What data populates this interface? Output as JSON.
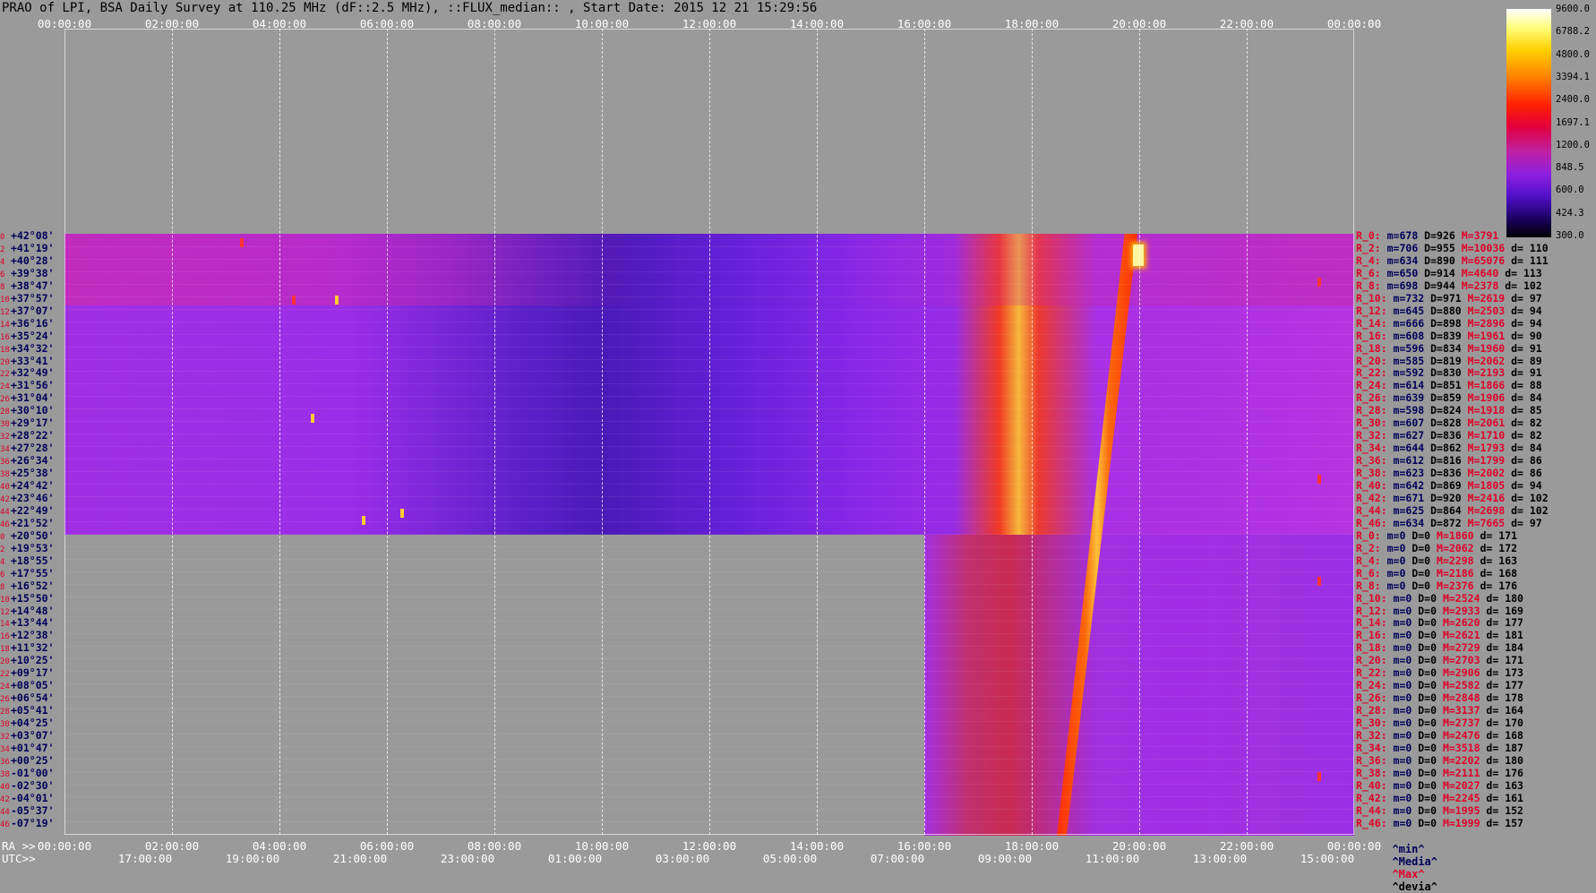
{
  "title": "PRAO of LPI, BSA Daily Survey at 110.25 MHz (dF::2.5 MHz), ::FLUX_median:: , Start Date: 2015 12 21 15:29:56",
  "top_ticks": [
    "00:00:00",
    "02:00:00",
    "04:00:00",
    "06:00:00",
    "08:00:00",
    "10:00:00",
    "12:00:00",
    "14:00:00",
    "16:00:00",
    "18:00:00",
    "20:00:00",
    "22:00:00",
    "00:00:00"
  ],
  "bottom_ra_ticks": [
    "00:00:00",
    "02:00:00",
    "04:00:00",
    "06:00:00",
    "08:00:00",
    "10:00:00",
    "12:00:00",
    "14:00:00",
    "16:00:00",
    "18:00:00",
    "20:00:00",
    "22:00:00",
    "00:00:00"
  ],
  "bottom_utc_ticks": [
    "17:00:00",
    "19:00:00",
    "21:00:00",
    "23:00:00",
    "01:00:00",
    "03:00:00",
    "05:00:00",
    "07:00:00",
    "09:00:00",
    "11:00:00",
    "13:00:00",
    "15:00:00"
  ],
  "ra_label": "RA >>",
  "utc_label": "UTC>>",
  "declinations": [
    {
      "idx": "0",
      "val": "+42°08'"
    },
    {
      "idx": "2",
      "val": "+41°19'"
    },
    {
      "idx": "4",
      "val": "+40°28'"
    },
    {
      "idx": "6",
      "val": "+39°38'"
    },
    {
      "idx": "8",
      "val": "+38°47'"
    },
    {
      "idx": "10",
      "val": "+37°57'"
    },
    {
      "idx": "12",
      "val": "+37°07'"
    },
    {
      "idx": "14",
      "val": "+36°16'"
    },
    {
      "idx": "16",
      "val": "+35°24'"
    },
    {
      "idx": "18",
      "val": "+34°32'"
    },
    {
      "idx": "20",
      "val": "+33°41'"
    },
    {
      "idx": "22",
      "val": "+32°49'"
    },
    {
      "idx": "24",
      "val": "+31°56'"
    },
    {
      "idx": "26",
      "val": "+31°04'"
    },
    {
      "idx": "28",
      "val": "+30°10'"
    },
    {
      "idx": "30",
      "val": "+29°17'"
    },
    {
      "idx": "32",
      "val": "+28°22'"
    },
    {
      "idx": "34",
      "val": "+27°28'"
    },
    {
      "idx": "36",
      "val": "+26°34'"
    },
    {
      "idx": "38",
      "val": "+25°38'"
    },
    {
      "idx": "40",
      "val": "+24°42'"
    },
    {
      "idx": "42",
      "val": "+23°46'"
    },
    {
      "idx": "44",
      "val": "+22°49'"
    },
    {
      "idx": "46",
      "val": "+21°52'"
    },
    {
      "idx": "0",
      "val": "+20°50'"
    },
    {
      "idx": "2",
      "val": "+19°53'"
    },
    {
      "idx": "4",
      "val": "+18°55'"
    },
    {
      "idx": "6",
      "val": "+17°55'"
    },
    {
      "idx": "8",
      "val": "+16°52'"
    },
    {
      "idx": "10",
      "val": "+15°50'"
    },
    {
      "idx": "12",
      "val": "+14°48'"
    },
    {
      "idx": "14",
      "val": "+13°44'"
    },
    {
      "idx": "16",
      "val": "+12°38'"
    },
    {
      "idx": "18",
      "val": "+11°32'"
    },
    {
      "idx": "20",
      "val": "+10°25'"
    },
    {
      "idx": "22",
      "val": "+09°17'"
    },
    {
      "idx": "24",
      "val": "+08°05'"
    },
    {
      "idx": "26",
      "val": "+06°54'"
    },
    {
      "idx": "28",
      "val": "+05°41'"
    },
    {
      "idx": "30",
      "val": "+04°25'"
    },
    {
      "idx": "32",
      "val": "+03°07'"
    },
    {
      "idx": "34",
      "val": "+01°47'"
    },
    {
      "idx": "36",
      "val": "+00°25'"
    },
    {
      "idx": "38",
      "val": "-01°00'"
    },
    {
      "idx": "40",
      "val": "-02°30'"
    },
    {
      "idx": "42",
      "val": "-04°01'"
    },
    {
      "idx": "44",
      "val": "-05°37'"
    },
    {
      "idx": "46",
      "val": "-07°19'"
    }
  ],
  "stats": [
    {
      "r": "R_0:",
      "m": "m=678",
      "D": "D=926",
      "M": "M=3791",
      "d": ""
    },
    {
      "r": "R_2:",
      "m": "m=706",
      "D": "D=955",
      "M": "M=10036",
      "d": "d= 110"
    },
    {
      "r": "R_4:",
      "m": "m=634",
      "D": "D=890",
      "M": "M=65076",
      "d": "d= 111"
    },
    {
      "r": "R_6:",
      "m": "m=650",
      "D": "D=914",
      "M": "M=4640",
      "d": "d= 113"
    },
    {
      "r": "R_8:",
      "m": "m=698",
      "D": "D=944",
      "M": "M=2378",
      "d": "d= 102"
    },
    {
      "r": "R_10:",
      "m": "m=732",
      "D": "D=971",
      "M": "M=2619",
      "d": "d= 97"
    },
    {
      "r": "R_12:",
      "m": "m=645",
      "D": "D=880",
      "M": "M=2503",
      "d": "d= 94"
    },
    {
      "r": "R_14:",
      "m": "m=666",
      "D": "D=898",
      "M": "M=2896",
      "d": "d= 94"
    },
    {
      "r": "R_16:",
      "m": "m=608",
      "D": "D=839",
      "M": "M=1961",
      "d": "d= 90"
    },
    {
      "r": "R_18:",
      "m": "m=596",
      "D": "D=834",
      "M": "M=1960",
      "d": "d= 91"
    },
    {
      "r": "R_20:",
      "m": "m=585",
      "D": "D=819",
      "M": "M=2062",
      "d": "d= 89"
    },
    {
      "r": "R_22:",
      "m": "m=592",
      "D": "D=830",
      "M": "M=2193",
      "d": "d= 91"
    },
    {
      "r": "R_24:",
      "m": "m=614",
      "D": "D=851",
      "M": "M=1866",
      "d": "d= 88"
    },
    {
      "r": "R_26:",
      "m": "m=639",
      "D": "D=859",
      "M": "M=1906",
      "d": "d= 84"
    },
    {
      "r": "R_28:",
      "m": "m=598",
      "D": "D=824",
      "M": "M=1918",
      "d": "d= 85"
    },
    {
      "r": "R_30:",
      "m": "m=607",
      "D": "D=828",
      "M": "M=2061",
      "d": "d= 82"
    },
    {
      "r": "R_32:",
      "m": "m=627",
      "D": "D=836",
      "M": "M=1710",
      "d": "d= 82"
    },
    {
      "r": "R_34:",
      "m": "m=644",
      "D": "D=862",
      "M": "M=1793",
      "d": "d= 84"
    },
    {
      "r": "R_36:",
      "m": "m=612",
      "D": "D=816",
      "M": "M=1799",
      "d": "d= 86"
    },
    {
      "r": "R_38:",
      "m": "m=623",
      "D": "D=836",
      "M": "M=2002",
      "d": "d= 86"
    },
    {
      "r": "R_40:",
      "m": "m=642",
      "D": "D=869",
      "M": "M=1805",
      "d": "d= 94"
    },
    {
      "r": "R_42:",
      "m": "m=671",
      "D": "D=920",
      "M": "M=2416",
      "d": "d= 102"
    },
    {
      "r": "R_44:",
      "m": "m=625",
      "D": "D=864",
      "M": "M=2698",
      "d": "d= 102"
    },
    {
      "r": "R_46:",
      "m": "m=634",
      "D": "D=872",
      "M": "M=7665",
      "d": "d= 97"
    },
    {
      "r": "R_0:",
      "m": "m=0",
      "D": "D=0",
      "M": "M=1860",
      "d": "d= 171"
    },
    {
      "r": "R_2:",
      "m": "m=0",
      "D": "D=0",
      "M": "M=2062",
      "d": "d= 172"
    },
    {
      "r": "R_4:",
      "m": "m=0",
      "D": "D=0",
      "M": "M=2298",
      "d": "d= 163"
    },
    {
      "r": "R_6:",
      "m": "m=0",
      "D": "D=0",
      "M": "M=2186",
      "d": "d= 168"
    },
    {
      "r": "R_8:",
      "m": "m=0",
      "D": "D=0",
      "M": "M=2376",
      "d": "d= 176"
    },
    {
      "r": "R_10:",
      "m": "m=0",
      "D": "D=0",
      "M": "M=2524",
      "d": "d= 180"
    },
    {
      "r": "R_12:",
      "m": "m=0",
      "D": "D=0",
      "M": "M=2933",
      "d": "d= 169"
    },
    {
      "r": "R_14:",
      "m": "m=0",
      "D": "D=0",
      "M": "M=2620",
      "d": "d= 177"
    },
    {
      "r": "R_16:",
      "m": "m=0",
      "D": "D=0",
      "M": "M=2621",
      "d": "d= 181"
    },
    {
      "r": "R_18:",
      "m": "m=0",
      "D": "D=0",
      "M": "M=2729",
      "d": "d= 184"
    },
    {
      "r": "R_20:",
      "m": "m=0",
      "D": "D=0",
      "M": "M=2703",
      "d": "d= 171"
    },
    {
      "r": "R_22:",
      "m": "m=0",
      "D": "D=0",
      "M": "M=2906",
      "d": "d= 173"
    },
    {
      "r": "R_24:",
      "m": "m=0",
      "D": "D=0",
      "M": "M=2582",
      "d": "d= 177"
    },
    {
      "r": "R_26:",
      "m": "m=0",
      "D": "D=0",
      "M": "M=2848",
      "d": "d= 178"
    },
    {
      "r": "R_28:",
      "m": "m=0",
      "D": "D=0",
      "M": "M=3137",
      "d": "d= 164"
    },
    {
      "r": "R_30:",
      "m": "m=0",
      "D": "D=0",
      "M": "M=2737",
      "d": "d= 170"
    },
    {
      "r": "R_32:",
      "m": "m=0",
      "D": "D=0",
      "M": "M=2476",
      "d": "d= 168"
    },
    {
      "r": "R_34:",
      "m": "m=0",
      "D": "D=0",
      "M": "M=3518",
      "d": "d= 187"
    },
    {
      "r": "R_36:",
      "m": "m=0",
      "D": "D=0",
      "M": "M=2202",
      "d": "d= 180"
    },
    {
      "r": "R_38:",
      "m": "m=0",
      "D": "D=0",
      "M": "M=2111",
      "d": "d= 176"
    },
    {
      "r": "R_40:",
      "m": "m=0",
      "D": "D=0",
      "M": "M=2027",
      "d": "d= 163"
    },
    {
      "r": "R_42:",
      "m": "m=0",
      "D": "D=0",
      "M": "M=2245",
      "d": "d= 161"
    },
    {
      "r": "R_44:",
      "m": "m=0",
      "D": "D=0",
      "M": "M=1995",
      "d": "d= 152"
    },
    {
      "r": "R_46:",
      "m": "m=0",
      "D": "D=0",
      "M": "M=1999",
      "d": "d= 157"
    }
  ],
  "colorbar_ticks": [
    "9600.0",
    "6788.2",
    "4800.0",
    "3394.1",
    "2400.0",
    "1697.1",
    "1200.0",
    "848.5",
    "600.0",
    "424.3",
    "300.0"
  ],
  "legend": {
    "min": "^min^",
    "median": "^Media^",
    "max": "^Max^",
    "dev": "^devia^"
  },
  "colors": {
    "background": "#9a9a9a",
    "label_red": "#e0002a",
    "label_navy": "#00005a"
  }
}
